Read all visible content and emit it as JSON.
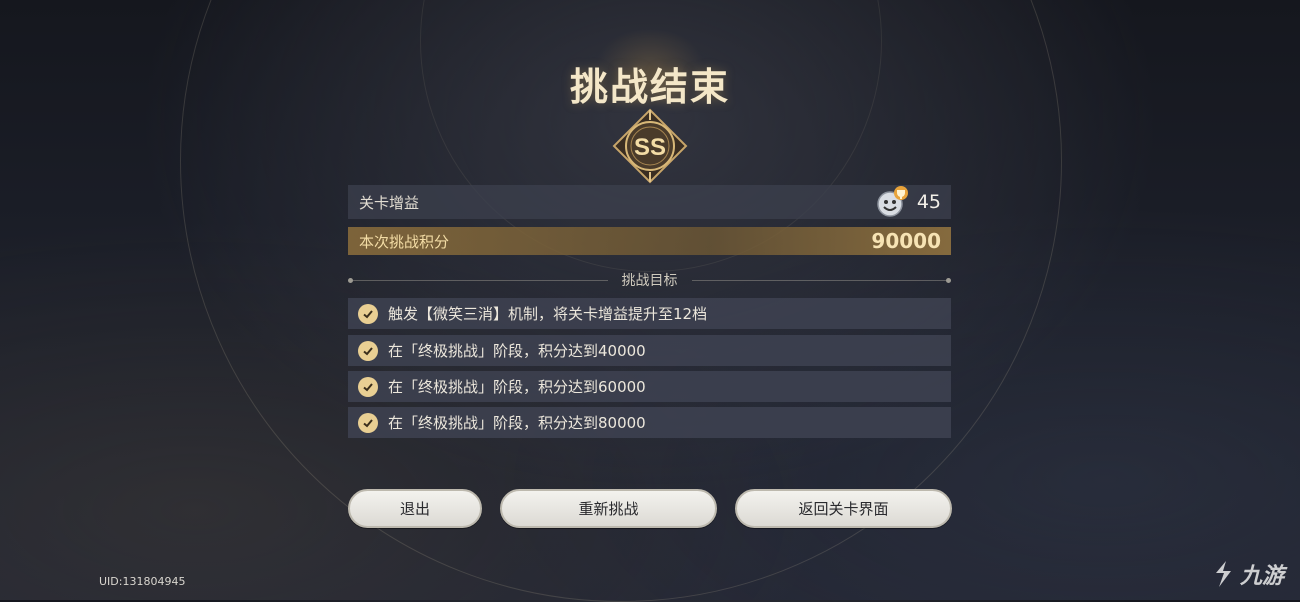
{
  "title": "挑战结束",
  "rank": "SS",
  "buff": {
    "label": "关卡增益",
    "value": "45"
  },
  "score": {
    "label": "本次挑战积分",
    "value": "90000"
  },
  "goals": {
    "header": "挑战目标",
    "items": [
      {
        "text": "触发【微笑三消】机制，将关卡增益提升至12档",
        "completed": true
      },
      {
        "text": "在「终极挑战」阶段，积分达到40000",
        "completed": true
      },
      {
        "text": "在「终极挑战」阶段，积分达到60000",
        "completed": true
      },
      {
        "text": "在「终极挑战」阶段，积分达到80000",
        "completed": true
      }
    ]
  },
  "buttons": {
    "exit": "退出",
    "retry": "重新挑战",
    "back": "返回关卡界面"
  },
  "uid": "UID:131804945",
  "watermark": "九游",
  "colors": {
    "accent_gold": "#e9cf93",
    "score_bar": "#8c6e3c",
    "button_bg": "#f3f2ee"
  }
}
